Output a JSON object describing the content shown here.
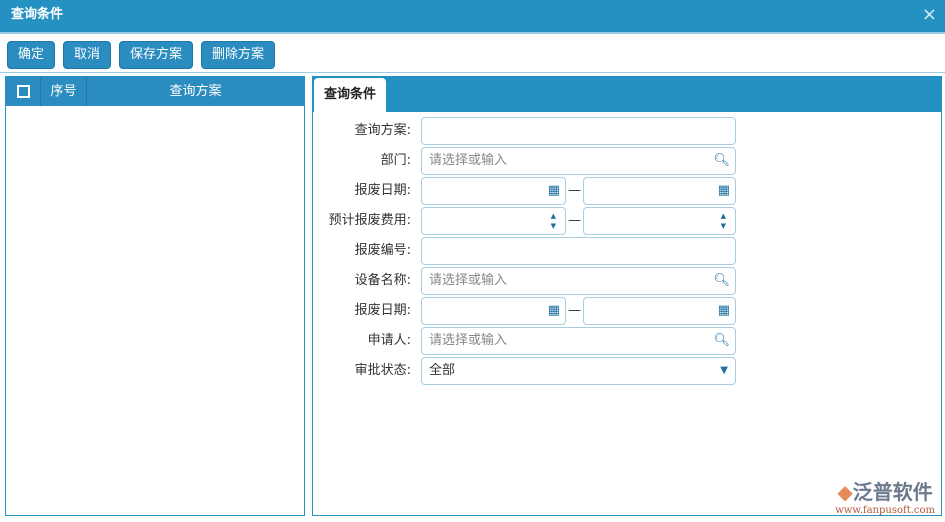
{
  "window": {
    "title": "查询条件",
    "close": "×"
  },
  "toolbar": {
    "confirm": "确定",
    "cancel": "取消",
    "save": "保存方案",
    "delete": "删除方案"
  },
  "list": {
    "columns": [
      "序号",
      "查询方案"
    ]
  },
  "tab": "查询条件",
  "form": {
    "scheme": {
      "label": "查询方案:",
      "value": ""
    },
    "dept": {
      "label": "部门:",
      "placeholder": "请选择或输入"
    },
    "date1": {
      "label": "报废日期:"
    },
    "cost": {
      "label": "预计报废费用:"
    },
    "code": {
      "label": "报废编号:",
      "value": ""
    },
    "device": {
      "label": "设备名称:",
      "placeholder": "请选择或输入"
    },
    "date2": {
      "label": "报废日期:"
    },
    "applicant": {
      "label": "申请人:",
      "placeholder": "请选择或输入"
    },
    "status": {
      "label": "审批状态:",
      "value": "全部"
    },
    "range_sep": "—"
  },
  "logo": {
    "name": "泛普软件",
    "url": "www.fanpusoft.com"
  }
}
